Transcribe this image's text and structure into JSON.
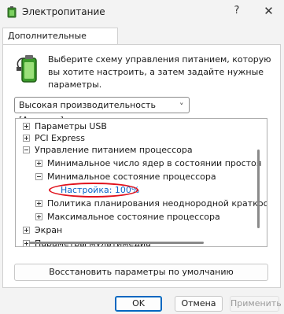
{
  "window": {
    "title": "Электропитание",
    "help_label": "?",
    "close_label": "✕",
    "icon": "power-options-icon"
  },
  "tab": {
    "label": "Дополнительные параметры"
  },
  "header": {
    "icon": "battery-plug-icon",
    "description": "Выберите схему управления питанием, которую вы хотите настроить, а затем задайте нужные параметры."
  },
  "plan_select": {
    "value": "Высокая производительность [Активен]",
    "chevron": "˅"
  },
  "tree": {
    "items": [
      {
        "label": "Параметры USB",
        "state": "collapsed"
      },
      {
        "label": "PCI Express",
        "state": "collapsed"
      },
      {
        "label": "Управление питанием процессора",
        "state": "expanded"
      },
      {
        "label": "Минимальное число ядер в состоянии простоя",
        "state": "collapsed"
      },
      {
        "label": "Минимальное состояние процессора",
        "state": "expanded"
      },
      {
        "label": "Настройка: 100%",
        "state": "leaf"
      },
      {
        "label": "Политика планирования неоднородной краткосроч",
        "state": "collapsed"
      },
      {
        "label": "Максимальное состояние процессора",
        "state": "collapsed"
      },
      {
        "label": "Экран",
        "state": "collapsed"
      },
      {
        "label": "Параметры мультимедиа",
        "state": "collapsed"
      }
    ],
    "highlight_color": "#e0101b",
    "link_color": "#0a64c8"
  },
  "restore_button": {
    "label": "Восстановить параметры по умолчанию"
  },
  "buttons": {
    "ok": "OK",
    "cancel": "Отмена",
    "apply": "Применить"
  }
}
